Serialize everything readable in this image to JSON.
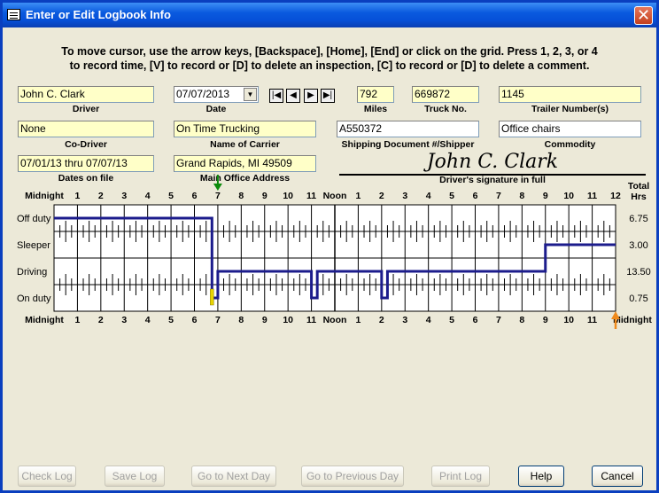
{
  "window": {
    "title": "Enter or Edit Logbook Info",
    "close_glyph": "✕"
  },
  "instructions": {
    "line1": "To move cursor, use the arrow keys, [Backspace], [Home], [End] or click on the grid.  Press 1, 2, 3, or 4",
    "line2": "to record time, [V] to record or [D] to delete an inspection, [C] to record or [D] to delete a comment."
  },
  "fields": {
    "driver": {
      "label": "Driver",
      "value": "John C. Clark"
    },
    "date": {
      "label": "Date",
      "value": "07/07/2013"
    },
    "miles": {
      "label": "Miles",
      "value": "792"
    },
    "truck_no": {
      "label": "Truck No.",
      "value": "669872"
    },
    "trailer": {
      "label": "Trailer Number(s)",
      "value": "1145"
    },
    "co_driver": {
      "label": "Co-Driver",
      "value": "None"
    },
    "carrier": {
      "label": "Name of Carrier",
      "value": "On Time Trucking"
    },
    "shipping": {
      "label": "Shipping Document #/Shipper",
      "value": "A550372"
    },
    "commodity": {
      "label": "Commodity",
      "value": "Office chairs"
    },
    "dates_on_file": {
      "label": "Dates on file",
      "value": "07/01/13 thru 07/07/13"
    },
    "main_office": {
      "label": "Main Office Address",
      "value": "Grand Rapids, MI  49509"
    },
    "signature": {
      "label": "Driver's signature in full",
      "value": "John C. Clark"
    }
  },
  "nav_buttons": [
    "first-icon",
    "prev-icon",
    "next-icon",
    "last-icon"
  ],
  "grid": {
    "hour_labels": [
      "Midnight",
      "1",
      "2",
      "3",
      "4",
      "5",
      "6",
      "7",
      "8",
      "9",
      "10",
      "11",
      "Noon",
      "1",
      "2",
      "3",
      "4",
      "5",
      "6",
      "7",
      "8",
      "9",
      "10",
      "11",
      "12"
    ],
    "bottom_hour_labels": [
      "Midnight",
      "1",
      "2",
      "3",
      "4",
      "5",
      "6",
      "7",
      "8",
      "9",
      "10",
      "11",
      "Noon",
      "1",
      "2",
      "3",
      "4",
      "5",
      "6",
      "7",
      "8",
      "9",
      "10",
      "11",
      "Midnight"
    ],
    "total_header": "Total\nHrs",
    "rows": [
      {
        "label": "Off duty",
        "total": "6.75"
      },
      {
        "label": "Sleeper",
        "total": "3.00"
      },
      {
        "label": "Driving",
        "total": "13.50"
      },
      {
        "label": "On duty",
        "total": "0.75"
      }
    ],
    "segments": [
      {
        "from": 0,
        "to": 6.75,
        "row": 0
      },
      {
        "from": 6.75,
        "to": 7.0,
        "row": 3
      },
      {
        "from": 7.0,
        "to": 11.0,
        "row": 2
      },
      {
        "from": 11.0,
        "to": 11.25,
        "row": 3
      },
      {
        "from": 11.25,
        "to": 14.0,
        "row": 2
      },
      {
        "from": 14.0,
        "to": 14.25,
        "row": 3
      },
      {
        "from": 14.25,
        "to": 21.0,
        "row": 2
      },
      {
        "from": 21.0,
        "to": 24.0,
        "row": 1
      }
    ],
    "inspection_marker_hour": 6.75,
    "top_marker_hour": 7.0,
    "cursor_hour": 24.0,
    "line_color": "#1c1c8c",
    "top_marker_color": "#0a8a0a",
    "cursor_color": "#f08a1c",
    "inspection_color": "#e8d400"
  },
  "buttons": {
    "check_log": "Check Log",
    "save_log": "Save Log",
    "next_day": "Go to Next Day",
    "prev_day": "Go to Previous Day",
    "print_log": "Print Log",
    "help": "Help",
    "cancel": "Cancel"
  }
}
